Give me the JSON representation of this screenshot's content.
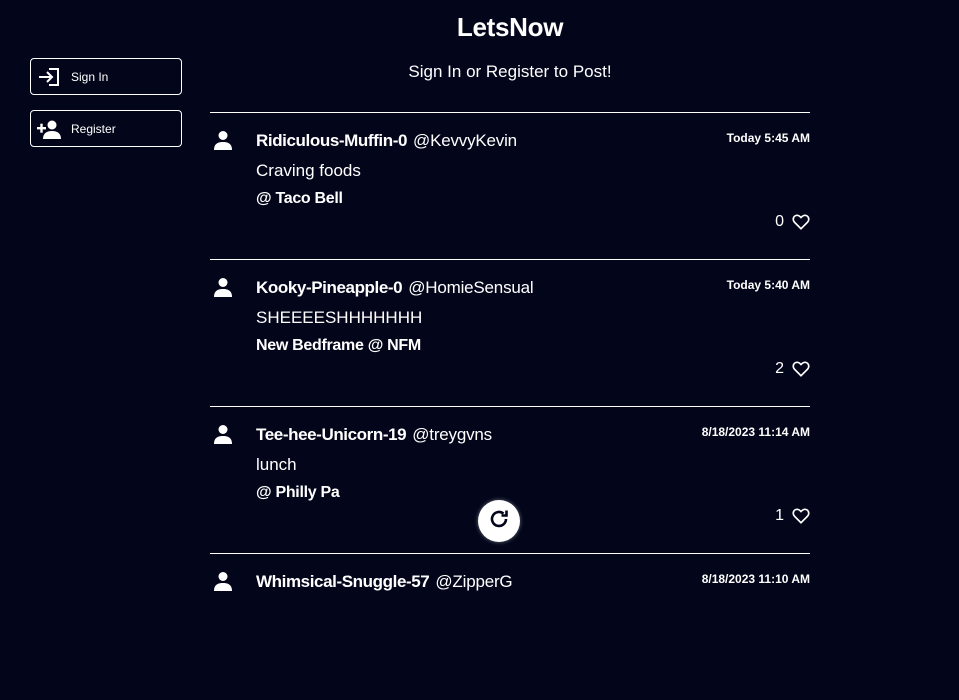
{
  "app": {
    "title": "LetsNow",
    "subtitle": "Sign In or Register to Post!"
  },
  "sidebar": {
    "sign_in_label": "Sign In",
    "register_label": "Register"
  },
  "posts": [
    {
      "name": "Ridiculous-Muffin-0",
      "handle": "@KevvyKevin",
      "time": "Today 5:45 AM",
      "body": "Craving foods",
      "location": "@ Taco Bell",
      "likes": "0"
    },
    {
      "name": "Kooky-Pineapple-0",
      "handle": "@HomieSensual",
      "time": "Today 5:40 AM",
      "body": "SHEEEESHHHHHHH",
      "location": "New Bedframe @ NFM",
      "likes": "2"
    },
    {
      "name": "Tee-hee-Unicorn-19",
      "handle": "@treygvns",
      "time": "8/18/2023 11:14 AM",
      "body": "lunch",
      "location": "@ Philly Pa",
      "likes": "1"
    },
    {
      "name": "Whimsical-Snuggle-57",
      "handle": "@ZipperG",
      "time": "8/18/2023 11:10 AM",
      "body": "",
      "location": "",
      "likes": ""
    }
  ],
  "colors": {
    "background": "#03061a",
    "text": "#ffffff"
  },
  "icons": {
    "sign_in": "login-icon",
    "register": "person-add-icon",
    "avatar": "person-icon",
    "like": "heart-outline-icon",
    "refresh": "refresh-icon"
  }
}
